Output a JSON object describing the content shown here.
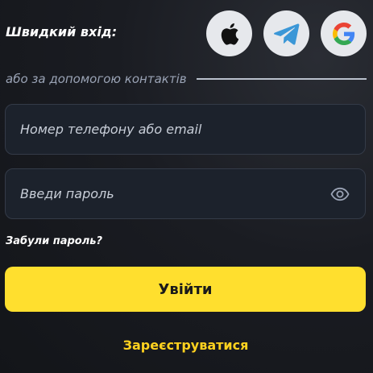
{
  "quick_login": {
    "label": "Швидкий вхід:",
    "providers": [
      {
        "icon": "apple-icon"
      },
      {
        "icon": "telegram-icon"
      },
      {
        "icon": "google-icon"
      }
    ]
  },
  "divider": {
    "text": "або за допомогою контактів"
  },
  "form": {
    "login_placeholder": "Номер телефону або email",
    "password_placeholder": "Введи пароль",
    "show_password_icon": "eye-icon",
    "forgot_label": "Забули пароль?",
    "submit_label": "Увійти",
    "register_label": "Зареєструватися"
  },
  "colors": {
    "accent": "#ffdf2e",
    "register_text": "#ffd21f",
    "background": "#1a1c22",
    "field_bg": "#1c222c"
  }
}
